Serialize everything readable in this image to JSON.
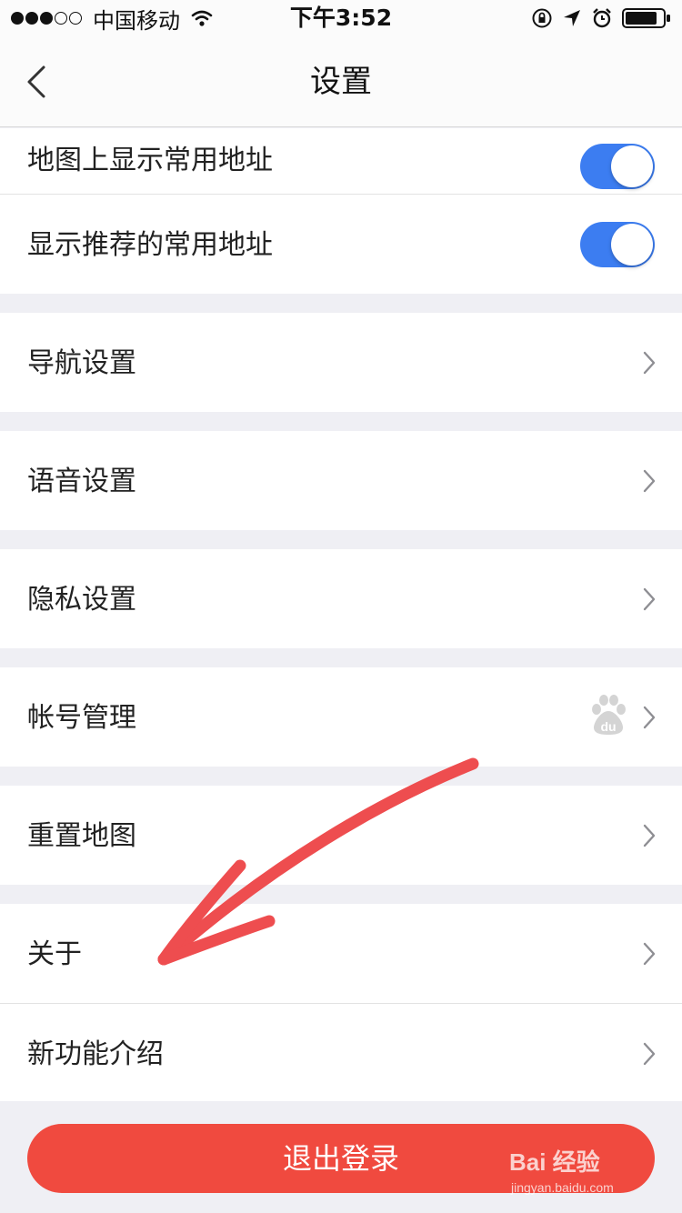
{
  "status_bar": {
    "carrier": "中国移动",
    "time": "下午3:52"
  },
  "nav": {
    "title": "设置",
    "back_icon": "chevron-left-icon"
  },
  "settings": {
    "toggles": [
      {
        "label": "地图上显示常用地址",
        "on": true
      },
      {
        "label": "显示推荐的常用地址",
        "on": true
      }
    ],
    "items": [
      {
        "label": "导航设置"
      },
      {
        "label": "语音设置"
      },
      {
        "label": "隐私设置"
      },
      {
        "label": "帐号管理",
        "icon": "baidu-paw-icon"
      },
      {
        "label": "重置地图"
      },
      {
        "label": "关于"
      },
      {
        "label": "新功能介绍"
      }
    ]
  },
  "logout_label": "退出登录",
  "watermark": {
    "brand": "Bai 经验",
    "url": "jingyan.baidu.com"
  },
  "colors": {
    "accent_blue": "#3c7df1",
    "logout_red": "#f04a3f",
    "arrow_red": "#ee4d4f",
    "background": "#efeff4"
  }
}
